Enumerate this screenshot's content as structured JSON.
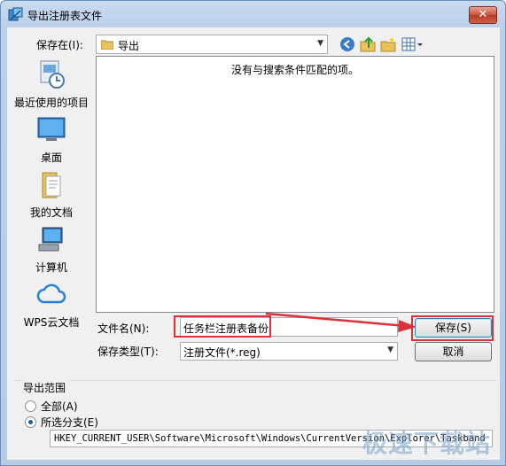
{
  "window": {
    "title": "导出注册表文件",
    "close_label": "✕"
  },
  "toolbar": {
    "save_in_label": "保存在(I):",
    "location": "导出"
  },
  "places": [
    {
      "label": "最近使用的项目",
      "icon": "recent-items-icon"
    },
    {
      "label": "桌面",
      "icon": "desktop-icon"
    },
    {
      "label": "我的文档",
      "icon": "documents-icon"
    },
    {
      "label": "计算机",
      "icon": "computer-icon"
    },
    {
      "label": "WPS云文档",
      "icon": "wps-cloud-icon"
    }
  ],
  "filelist": {
    "empty_message": "没有与搜索条件匹配的项。"
  },
  "form": {
    "filename_label": "文件名(N):",
    "filename_value": "任务栏注册表备份",
    "filetype_label": "保存类型(T):",
    "filetype_value": "注册文件(*.reg)",
    "save_button": "保存(S)",
    "cancel_button": "取消"
  },
  "export_range": {
    "title": "导出范围",
    "option_all": "全部(A)",
    "option_branch": "所选分支(E)",
    "branch_value": "HKEY_CURRENT_USER\\Software\\Microsoft\\Windows\\CurrentVersion\\Explorer\\Taskband"
  },
  "watermark": "极速下载站",
  "colors": {
    "highlight_red": "#d9323a",
    "titlebar": "#c9daef"
  }
}
